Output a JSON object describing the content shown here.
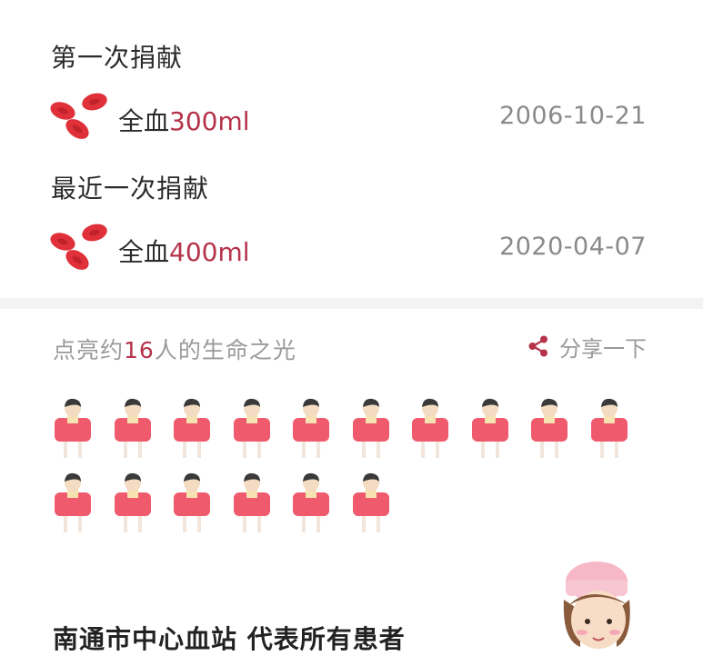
{
  "donations": {
    "first": {
      "title": "第一次捐献",
      "type": "全血",
      "amount": "300ml",
      "date": "2006-10-21"
    },
    "latest": {
      "title": "最近一次捐献",
      "type": "全血",
      "amount": "400ml",
      "date": "2020-04-07"
    }
  },
  "impact": {
    "prefix": "点亮约",
    "count": "16",
    "suffix": "人的生命之光",
    "people_lit": 16
  },
  "share": {
    "label": "分享一下",
    "icon": "share-icon"
  },
  "footer": {
    "text": "南通市中心血站 代表所有患者"
  },
  "colors": {
    "accent": "#b5324a",
    "blood_cell": "#e0303a",
    "shirt": "#ef5a6c",
    "divider": "#f3f3f3",
    "muted_text": "#9a9a9a"
  }
}
